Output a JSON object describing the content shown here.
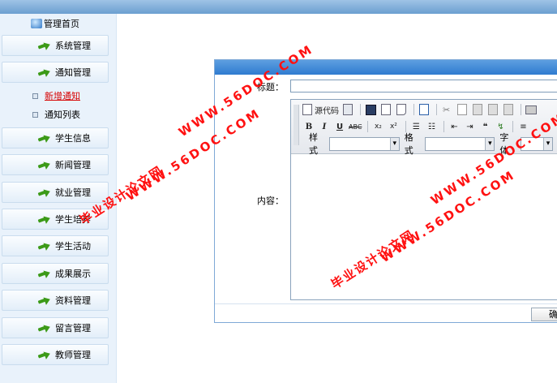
{
  "sidebar": {
    "home_label": "管理首页",
    "items": [
      {
        "label": "系统管理"
      },
      {
        "label": "通知管理"
      },
      {
        "label": "学生信息"
      },
      {
        "label": "新闻管理"
      },
      {
        "label": "就业管理"
      },
      {
        "label": "学生培养"
      },
      {
        "label": "学生活动"
      },
      {
        "label": "成果展示"
      },
      {
        "label": "资料管理"
      },
      {
        "label": "留言管理"
      },
      {
        "label": "教师管理"
      }
    ],
    "sub_items": [
      {
        "label": "新增通知",
        "active": true
      },
      {
        "label": "通知列表",
        "active": false
      }
    ]
  },
  "form": {
    "title_label": "标题：",
    "title_value": "",
    "content_label": "内容："
  },
  "editor": {
    "source_label": "源代码",
    "style_label": "样式",
    "format_label": "格式",
    "font_label": "字体",
    "bold": "B",
    "italic": "I",
    "underline": "U",
    "strike": "ABC",
    "subscript": "x₂",
    "superscript": "x²"
  },
  "footer": {
    "confirm_label": "确定"
  },
  "watermark": {
    "cn": "毕业设计论文网",
    "url": "WWW.56DOC.COM"
  },
  "colors": {
    "topbar": "#7aaad9",
    "sidebar": "#e9f2fb",
    "watermark": "#ff1111",
    "active_sub": "#d60000"
  }
}
